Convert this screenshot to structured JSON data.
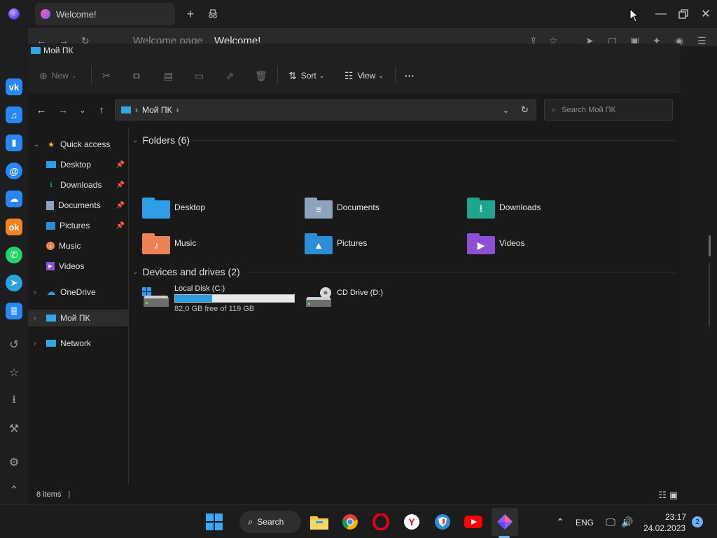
{
  "browser": {
    "tab_title": "Welcome!",
    "address_faded": "Welcome page",
    "address_title": "Welcome!"
  },
  "explorer": {
    "window_title": "Мой ПК",
    "commands": {
      "new": "New",
      "sort": "Sort",
      "view": "View",
      "more": "···"
    },
    "address": "Мой ПК",
    "search_placeholder": "Search Мой ПК",
    "nav": {
      "quick_access": "Quick access",
      "desktop": "Desktop",
      "downloads": "Downloads",
      "documents": "Documents",
      "pictures": "Pictures",
      "music": "Music",
      "videos": "Videos",
      "onedrive": "OneDrive",
      "this_pc": "Мой ПК",
      "network": "Network"
    },
    "folders_header": "Folders (6)",
    "folders": [
      {
        "name": "Desktop",
        "color": "#2f9ee8",
        "glyph": ""
      },
      {
        "name": "Documents",
        "color": "#8ea4bd",
        "glyph": "≡"
      },
      {
        "name": "Downloads",
        "color": "#1fa58d",
        "glyph": "⭳"
      },
      {
        "name": "Music",
        "color": "#ef8157",
        "glyph": "♪"
      },
      {
        "name": "Pictures",
        "color": "#2a8fd6",
        "glyph": "▲"
      },
      {
        "name": "Videos",
        "color": "#8d4fd6",
        "glyph": "▶"
      }
    ],
    "drives_header": "Devices and drives (2)",
    "drives": {
      "c_name": "Local Disk (C:)",
      "c_free": "82,0 GB free of 119 GB",
      "c_used_fraction": 0.31,
      "d_name": "CD Drive (D:)"
    },
    "status": "8 items"
  },
  "taskbar": {
    "search": "Search",
    "lang": "ENG",
    "time": "23:17",
    "date": "24.02.2023",
    "notifications": "2"
  }
}
